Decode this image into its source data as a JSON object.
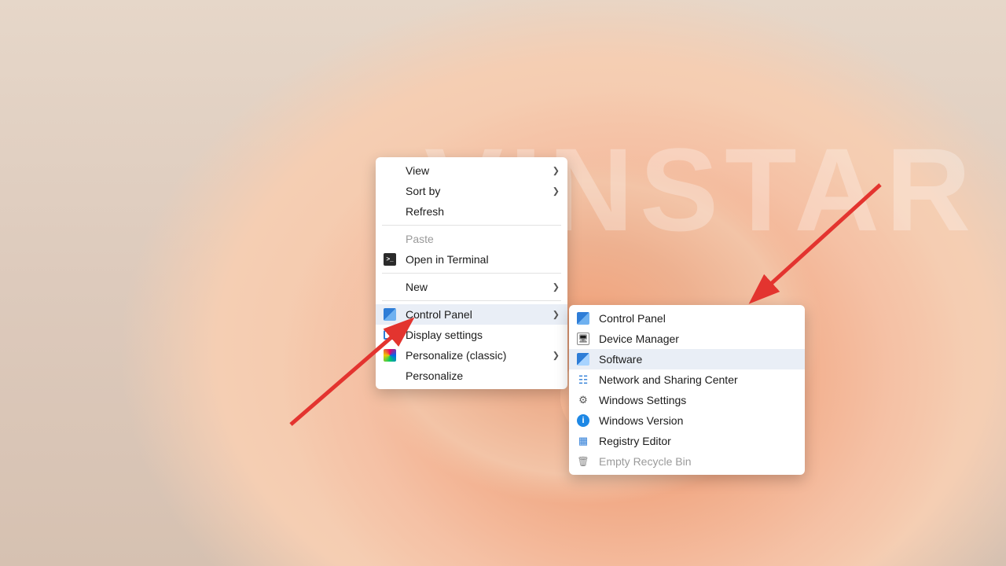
{
  "watermark": "VINSTAR",
  "main_menu": {
    "view": {
      "label": "View",
      "submenu": true
    },
    "sortby": {
      "label": "Sort by",
      "submenu": true
    },
    "refresh": {
      "label": "Refresh"
    },
    "paste": {
      "label": "Paste",
      "disabled": true
    },
    "terminal": {
      "label": "Open in Terminal",
      "icon": "term"
    },
    "new": {
      "label": "New",
      "submenu": true
    },
    "cpanel": {
      "label": "Control Panel",
      "icon": "cpanel",
      "submenu": true,
      "hover": true
    },
    "display": {
      "label": "Display settings",
      "icon": "disp"
    },
    "persclassic": {
      "label": "Personalize (classic)",
      "icon": "pers",
      "submenu": true
    },
    "personalize": {
      "label": "Personalize"
    }
  },
  "sub_menu": {
    "cpanel": {
      "label": "Control Panel",
      "icon": "cpanel"
    },
    "devmgr": {
      "label": "Device Manager",
      "icon": "dev"
    },
    "software": {
      "label": "Software",
      "icon": "soft",
      "hover": true
    },
    "netshare": {
      "label": "Network and Sharing Center",
      "icon": "net"
    },
    "winset": {
      "label": "Windows Settings",
      "icon": "set"
    },
    "winver": {
      "label": "Windows Version",
      "icon": "info"
    },
    "regedit": {
      "label": "Registry Editor",
      "icon": "reg"
    },
    "emptybin": {
      "label": "Empty Recycle Bin",
      "icon": "bin",
      "disabled": true
    }
  },
  "annotation": {
    "arrow_color": "#e3342f"
  }
}
